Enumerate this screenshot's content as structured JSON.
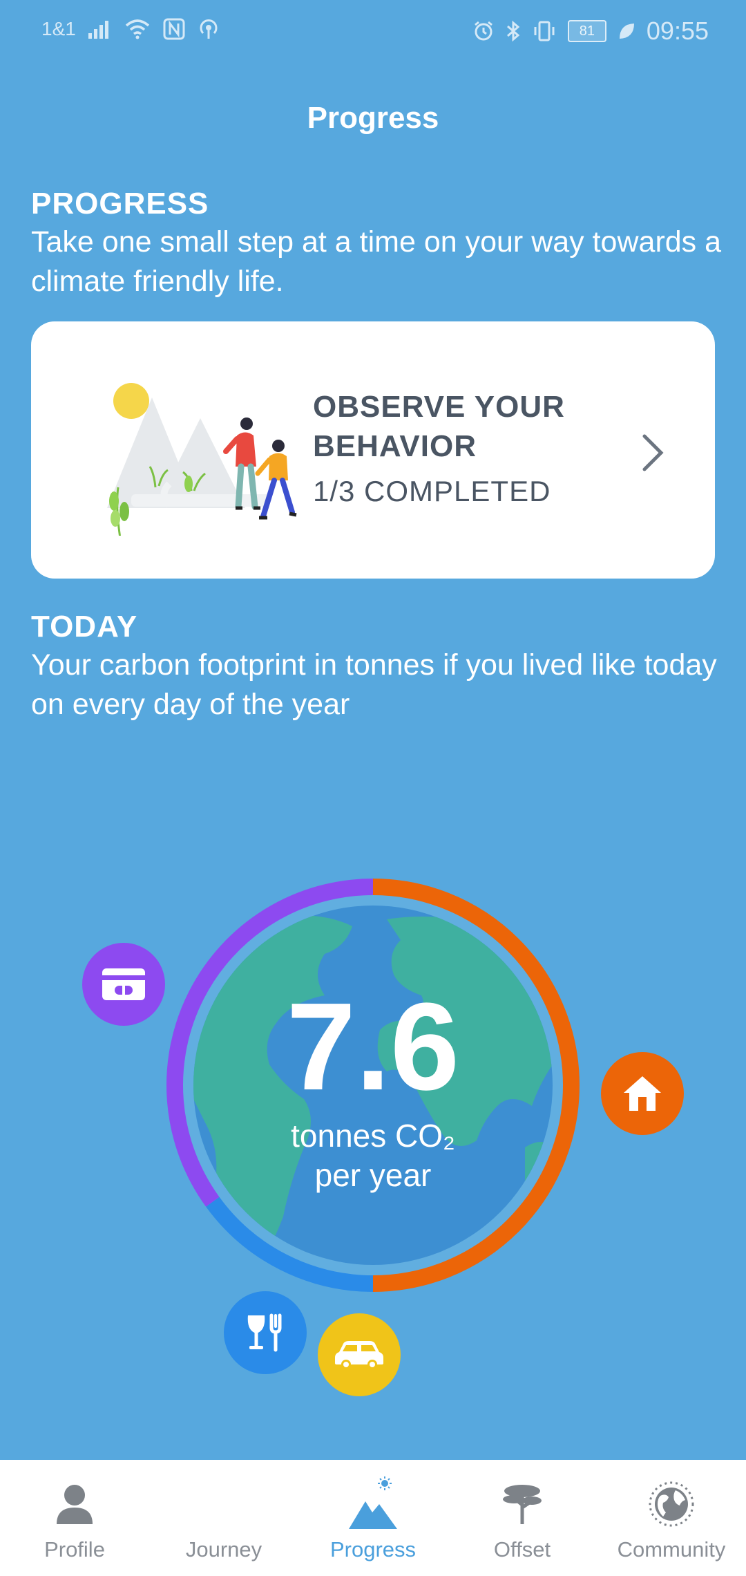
{
  "status_bar": {
    "carrier": "1&1",
    "battery": "81",
    "time": "09:55"
  },
  "page": {
    "title": "Progress"
  },
  "progress_section": {
    "heading": "PROGRESS",
    "text": "Take one small step at a time on your way towards a climate friendly life."
  },
  "behavior_card": {
    "title": "OBSERVE YOUR BEHAVIOR",
    "status": "1/3 COMPLETED"
  },
  "today_section": {
    "heading": "TODAY",
    "text": "Your carbon footprint in tonnes if you lived like today on every day of the year"
  },
  "footprint": {
    "value": "7.6",
    "unit_line1": "tonnes CO₂",
    "unit_line2": "per year",
    "ring_share": {
      "home": 0.5,
      "food": 0.15,
      "consumption": 0.35
    },
    "categories": [
      {
        "name": "consumption",
        "icon": "credit-card-icon",
        "color": "#8d4af0"
      },
      {
        "name": "home",
        "icon": "home-icon",
        "color": "#ec6508"
      },
      {
        "name": "food",
        "icon": "food-icon",
        "color": "#2a8be8"
      },
      {
        "name": "transport",
        "icon": "car-icon",
        "color": "#f0c419"
      }
    ]
  },
  "nav": {
    "items": [
      {
        "label": "Profile",
        "icon": "profile-icon"
      },
      {
        "label": "Journey",
        "icon": "journey-icon"
      },
      {
        "label": "Progress",
        "icon": "progress-icon",
        "active": true
      },
      {
        "label": "Offset",
        "icon": "tree-icon"
      },
      {
        "label": "Community",
        "icon": "globe-icon"
      }
    ]
  },
  "colors": {
    "background": "#57a8de",
    "card_text": "#4a5563",
    "active_nav": "#4a9fdc",
    "inactive_nav": "#8a8f96"
  }
}
